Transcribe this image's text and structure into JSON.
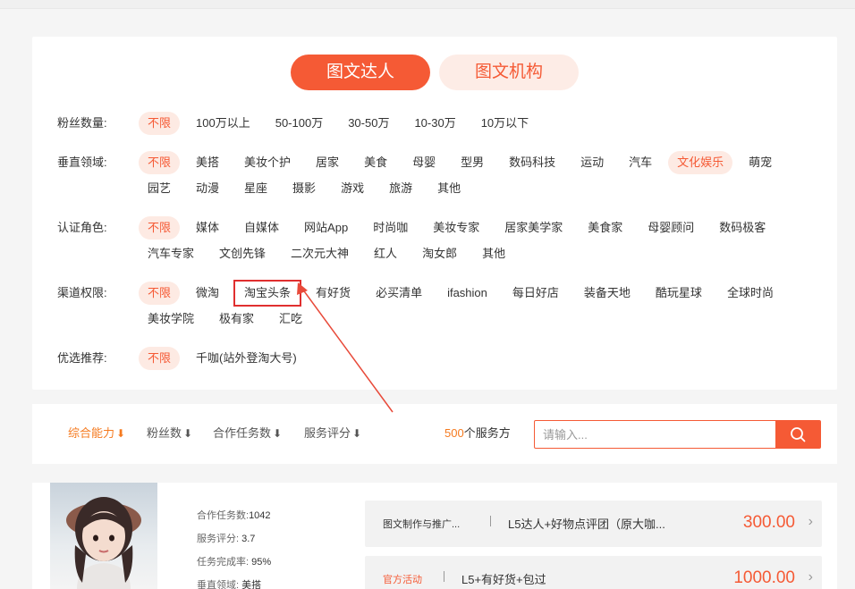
{
  "tabs": [
    {
      "label": "图文达人"
    },
    {
      "label": "图文机构"
    }
  ],
  "filters": [
    {
      "label": "粉丝数量:",
      "options": [
        "不限",
        "100万以上",
        "50-100万",
        "30-50万",
        "10-30万",
        "10万以下"
      ]
    },
    {
      "label": "垂直领域:",
      "options": [
        "不限",
        "美搭",
        "美妆个护",
        "居家",
        "美食",
        "母婴",
        "型男",
        "数码科技",
        "运动",
        "汽车",
        "文化娱乐",
        "萌宠",
        "园艺",
        "动漫",
        "星座",
        "摄影",
        "游戏",
        "旅游",
        "其他"
      ]
    },
    {
      "label": "认证角色:",
      "options": [
        "不限",
        "媒体",
        "自媒体",
        "网站App",
        "时尚咖",
        "美妆专家",
        "居家美学家",
        "美食家",
        "母婴顾问",
        "数码极客",
        "汽车专家",
        "文创先锋",
        "二次元大神",
        "红人",
        "淘女郎",
        "其他"
      ]
    },
    {
      "label": "渠道权限:",
      "options": [
        "不限",
        "微淘",
        "淘宝头条",
        "有好货",
        "必买清单",
        "ifashion",
        "每日好店",
        "装备天地",
        "酷玩星球",
        "全球时尚",
        "美妆学院",
        "极有家",
        "汇吃"
      ]
    },
    {
      "label": "优选推荐:",
      "options": [
        "不限",
        "千咖(站外登淘大号)"
      ]
    }
  ],
  "sort": {
    "items": [
      {
        "label": "综合能力",
        "arrow": "⬇"
      },
      {
        "label": "粉丝数",
        "arrow": "⬇"
      },
      {
        "label": "合作任务数",
        "arrow": "⬇"
      },
      {
        "label": "服务评分",
        "arrow": "⬇"
      }
    ],
    "count_num": "500",
    "count_suffix": "个服务方",
    "search_placeholder": "请输入..."
  },
  "result": {
    "stats": [
      {
        "label": "合作任务数:",
        "value": "1042"
      },
      {
        "label": "服务评分:",
        "value": "3.7"
      },
      {
        "label": "任务完成率:",
        "value": "95%"
      },
      {
        "label": "垂直领域:",
        "value": "美搭"
      }
    ],
    "services": [
      {
        "category": "图文制作与推广...",
        "title": "L5达人+好物点评团（原大咖...",
        "price": "300.00"
      },
      {
        "category": "官方活动",
        "title": "L5+有好货+包过",
        "price": "1000.00"
      }
    ]
  },
  "colors": {
    "accent": "#f55a35",
    "accent_light": "#fdeae3",
    "highlight_box": "#e02f2f",
    "sort_active": "#f57a1f"
  }
}
